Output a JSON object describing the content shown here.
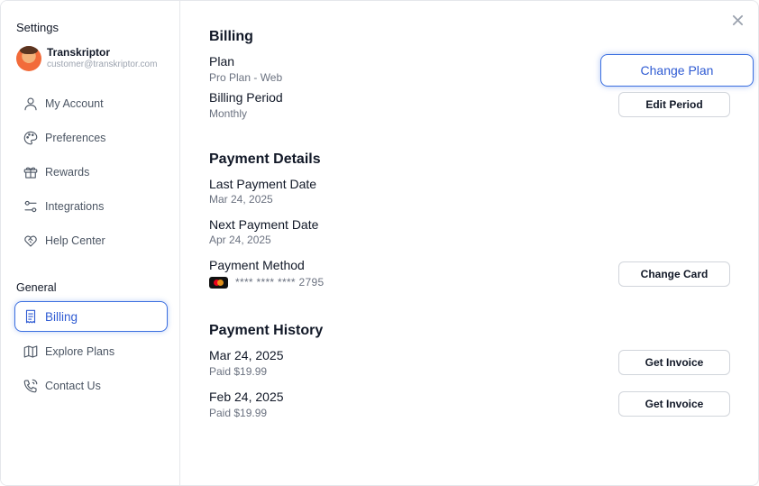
{
  "sidebar": {
    "title": "Settings",
    "profile": {
      "name": "Transkriptor",
      "email": "customer@transkriptor.com"
    },
    "items": [
      {
        "label": "My Account",
        "icon": "user-icon"
      },
      {
        "label": "Preferences",
        "icon": "palette-icon"
      },
      {
        "label": "Rewards",
        "icon": "gift-icon"
      },
      {
        "label": "Integrations",
        "icon": "sliders-icon"
      },
      {
        "label": "Help Center",
        "icon": "heart-handshake-icon"
      }
    ],
    "section_title": "General",
    "general_items": [
      {
        "label": "Billing",
        "icon": "receipt-icon",
        "active": true
      },
      {
        "label": "Explore Plans",
        "icon": "map-icon"
      },
      {
        "label": "Contact Us",
        "icon": "phone-icon"
      }
    ]
  },
  "billing": {
    "heading": "Billing",
    "plan_label": "Plan",
    "plan_value": "Pro Plan - Web",
    "period_label": "Billing Period",
    "period_value": "Monthly",
    "change_plan_button": "Change Plan",
    "edit_period_button": "Edit Period"
  },
  "payment_details": {
    "heading": "Payment Details",
    "last_label": "Last Payment Date",
    "last_value": "Mar 24, 2025",
    "next_label": "Next Payment Date",
    "next_value": "Apr 24, 2025",
    "method_label": "Payment Method",
    "card_number": "**** **** **** 2795",
    "card_brand_icon": "mastercard-icon",
    "change_card_button": "Change Card"
  },
  "payment_history": {
    "heading": "Payment History",
    "entries": [
      {
        "date": "Mar 24, 2025",
        "amount": "Paid $19.99",
        "button": "Get Invoice"
      },
      {
        "date": "Feb 24, 2025",
        "amount": "Paid $19.99",
        "button": "Get Invoice"
      }
    ]
  },
  "colors": {
    "accent": "#2f5bd3",
    "border": "#e5e7eb",
    "muted": "#6b7280"
  }
}
